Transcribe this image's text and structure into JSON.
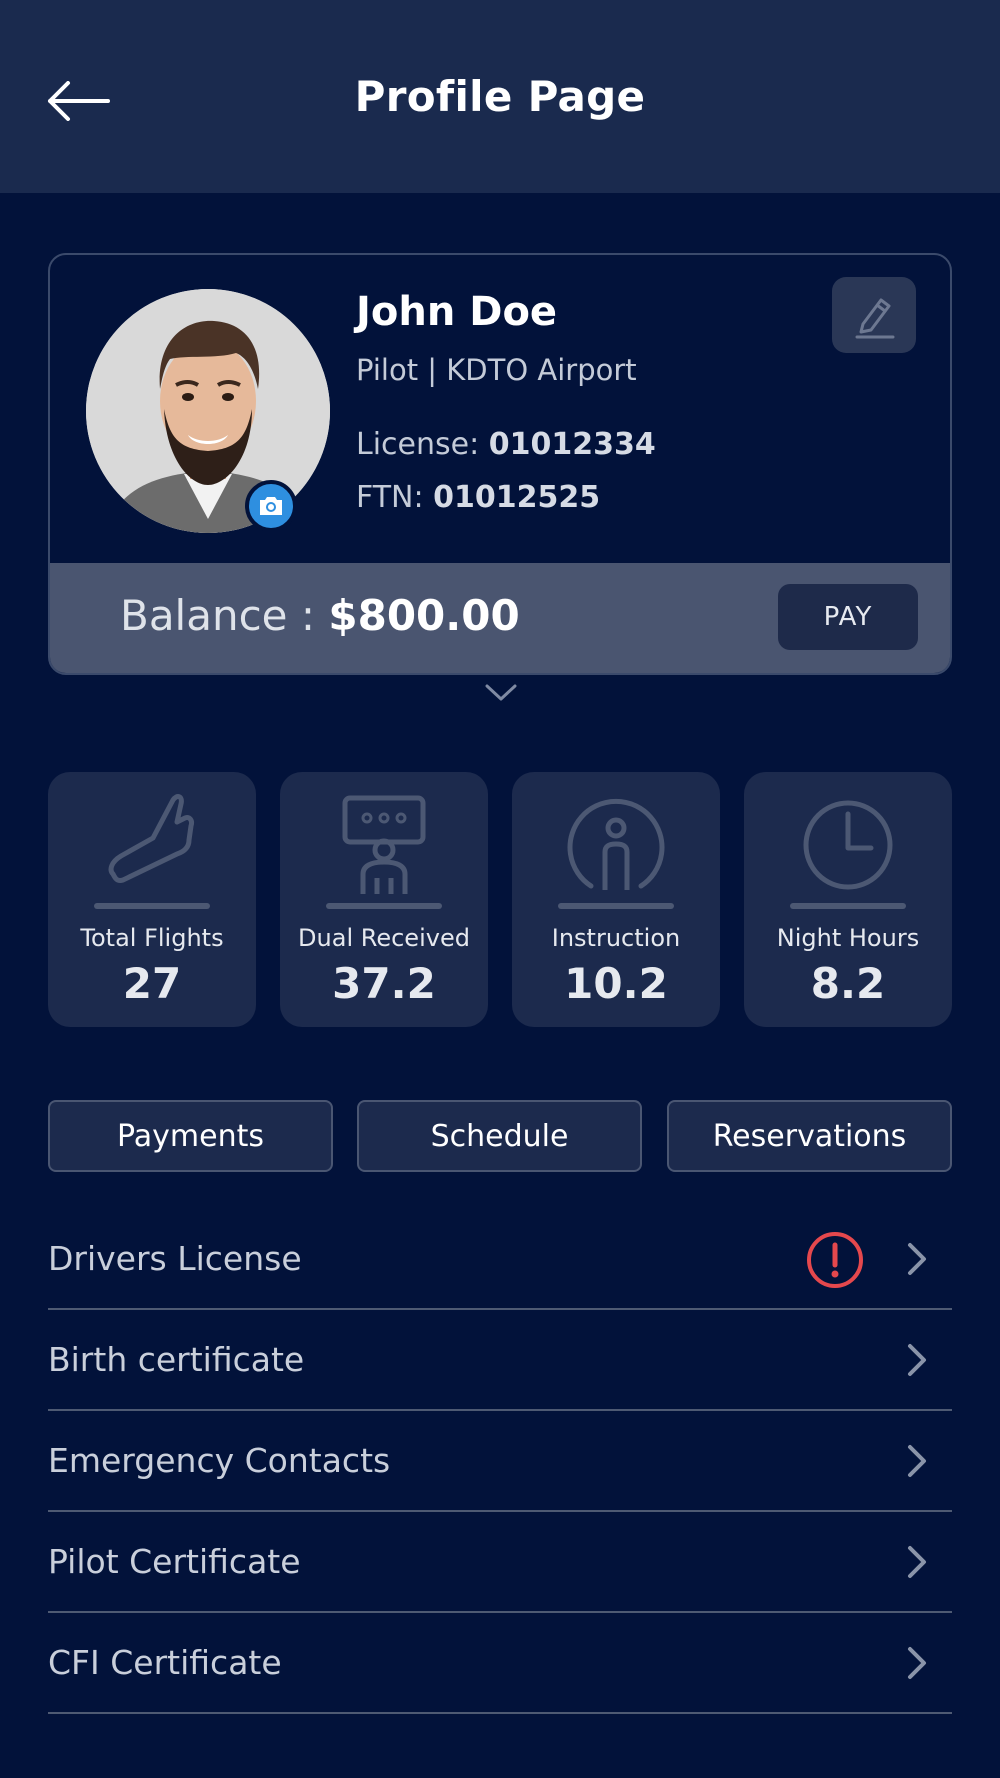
{
  "header": {
    "title": "Profile Page",
    "back_icon": "arrow-left-icon"
  },
  "profile": {
    "name": "John Doe",
    "role": "Pilot |  KDTO Airport",
    "license_label": "License:",
    "license_value": "01012334",
    "ftn_label": "FTN:",
    "ftn_value": "01012525",
    "edit_icon": "pencil-icon",
    "camera_icon": "camera-icon",
    "balance_label": "Balance :",
    "balance_value": "$800.00",
    "pay_label": "PAY"
  },
  "stats": [
    {
      "icon": "airplane-icon",
      "label": "Total Flights",
      "value": "27"
    },
    {
      "icon": "instructor-icon",
      "label": "Dual Received",
      "value": "37.2"
    },
    {
      "icon": "person-circle-icon",
      "label": "Instruction",
      "value": "10.2"
    },
    {
      "icon": "clock-icon",
      "label": "Night Hours",
      "value": "8.2"
    }
  ],
  "tabs": [
    {
      "label": "Payments"
    },
    {
      "label": "Schedule"
    },
    {
      "label": "Reservations"
    }
  ],
  "documents": [
    {
      "label": "Drivers License",
      "alert": true
    },
    {
      "label": "Birth certificate",
      "alert": false
    },
    {
      "label": "Emergency Contacts",
      "alert": false
    },
    {
      "label": "Pilot Certificate",
      "alert": false
    },
    {
      "label": "CFI Certificate",
      "alert": false
    }
  ],
  "colors": {
    "background": "#02123a",
    "header": "#1a2a4e",
    "card": "#1c2a4d",
    "accent_blue": "#2e8fe0",
    "alert_red": "#e5484d"
  }
}
